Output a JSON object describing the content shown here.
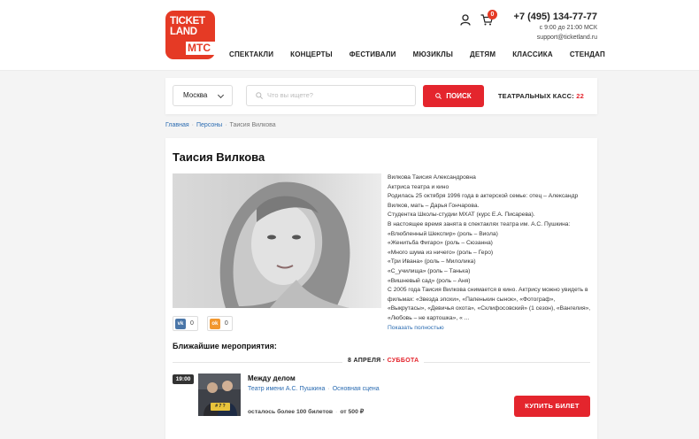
{
  "header": {
    "logo": {
      "line1": "TICKET",
      "line2": "LAND",
      "brand": "МТС"
    },
    "cart_count": "0",
    "phone": "+7 (495) 134-77-77",
    "hours": "с 9:00 до 21:00 МСК",
    "email": "support@ticketland.ru",
    "nav": [
      "СПЕКТАКЛИ",
      "КОНЦЕРТЫ",
      "ФЕСТИВАЛИ",
      "МЮЗИКЛЫ",
      "ДЕТЯМ",
      "КЛАССИКА",
      "СТЕНДАП"
    ]
  },
  "search": {
    "city": "Москва",
    "placeholder": "Что вы ищете?",
    "button": "ПОИСК",
    "kass_label": "ТЕАТРАЛЬНЫХ КАСС:",
    "kass_count": "22"
  },
  "breadcrumbs": [
    "Главная",
    "Персоны",
    "Таисия Вилкова"
  ],
  "person": {
    "name": "Таисия Вилкова",
    "bio": [
      "Вилкова Таисия Александровна",
      "Актриса театра и кино",
      "Родилась 25 октября 1996 года в актерской семье: отец – Александр Вилков, мать – Дарья Гончарова.",
      "Студентка Школы-студии МХАТ (курс Е.А. Писарева).",
      "В настоящее время занята в спектаклях театра им. А.С. Пушкина:",
      "«Влюбленный Шекспир» (роль – Виола)",
      "«Женитьба Фигаро» (роль – Сюзанна)",
      "«Много шума из ничего» (роль – Геро)",
      "«Три Ивана» (роль – Милолика)",
      "«С_училища» (роль – Танька)",
      "«Вишневый сад» (роль – Аня)",
      "С 2005 года Таисия Вилкова снимается в кино. Актрису можно увидеть в фильмах: «Звезда эпохи», «Папенькин сынок», «Фотограф», «Выкрутасы», «Девичья охота», «Склифосовский» (1 сезон), «Вангелия», «Любовь – не картошка», « ..."
    ],
    "more": "Показать полностью",
    "social": {
      "vk_icon": "vk-icon",
      "vk_count": "0",
      "ok_icon": "odnoklassniki-icon",
      "ok_count": "0"
    }
  },
  "events": {
    "title": "Ближайшие мероприятия:",
    "date": "8 АПРЕЛЯ",
    "weekday": "СУББОТА",
    "item": {
      "time": "19:00",
      "thumb_badge": "# 7 ?",
      "title": "Между делом",
      "venue": "Театр имени А.С. Пушкина",
      "hall": "Основная сцена",
      "left": "осталось более 100 билетов",
      "price": "от 500 ₽",
      "buy": "КУПИТЬ БИЛЕТ"
    }
  },
  "colors": {
    "accent": "#e4252d",
    "link": "#2a6bb1",
    "logo": "#e53a25"
  }
}
